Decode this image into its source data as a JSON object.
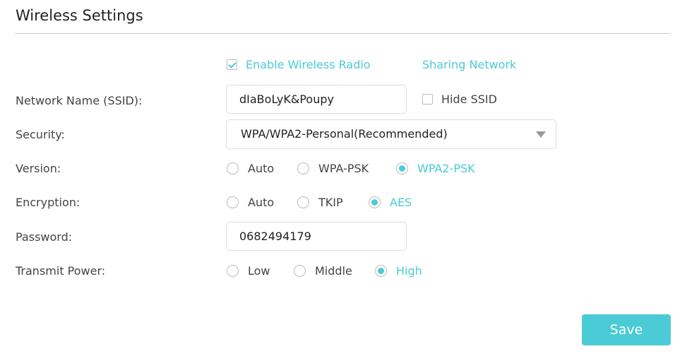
{
  "title": "Wireless Settings",
  "enable_radio": {
    "label": "Enable Wireless Radio",
    "checked": true
  },
  "sharing_network": "Sharing Network",
  "fields": {
    "ssid": {
      "label": "Network Name (SSID):",
      "value": "dIaBoLyK&Poupy"
    },
    "hide_ssid": {
      "label": "Hide SSID",
      "checked": false
    },
    "security": {
      "label": "Security:",
      "value": "WPA/WPA2-Personal(Recommended)"
    },
    "version": {
      "label": "Version:",
      "options": [
        "Auto",
        "WPA-PSK",
        "WPA2-PSK"
      ],
      "selected": "WPA2-PSK"
    },
    "encryption": {
      "label": "Encryption:",
      "options": [
        "Auto",
        "TKIP",
        "AES"
      ],
      "selected": "AES"
    },
    "password": {
      "label": "Password:",
      "value": "0682494179"
    },
    "transmit_power": {
      "label": "Transmit Power:",
      "options": [
        "Low",
        "Middle",
        "High"
      ],
      "selected": "High"
    }
  },
  "save_label": "Save",
  "colors": {
    "accent": "#4acbd6"
  }
}
